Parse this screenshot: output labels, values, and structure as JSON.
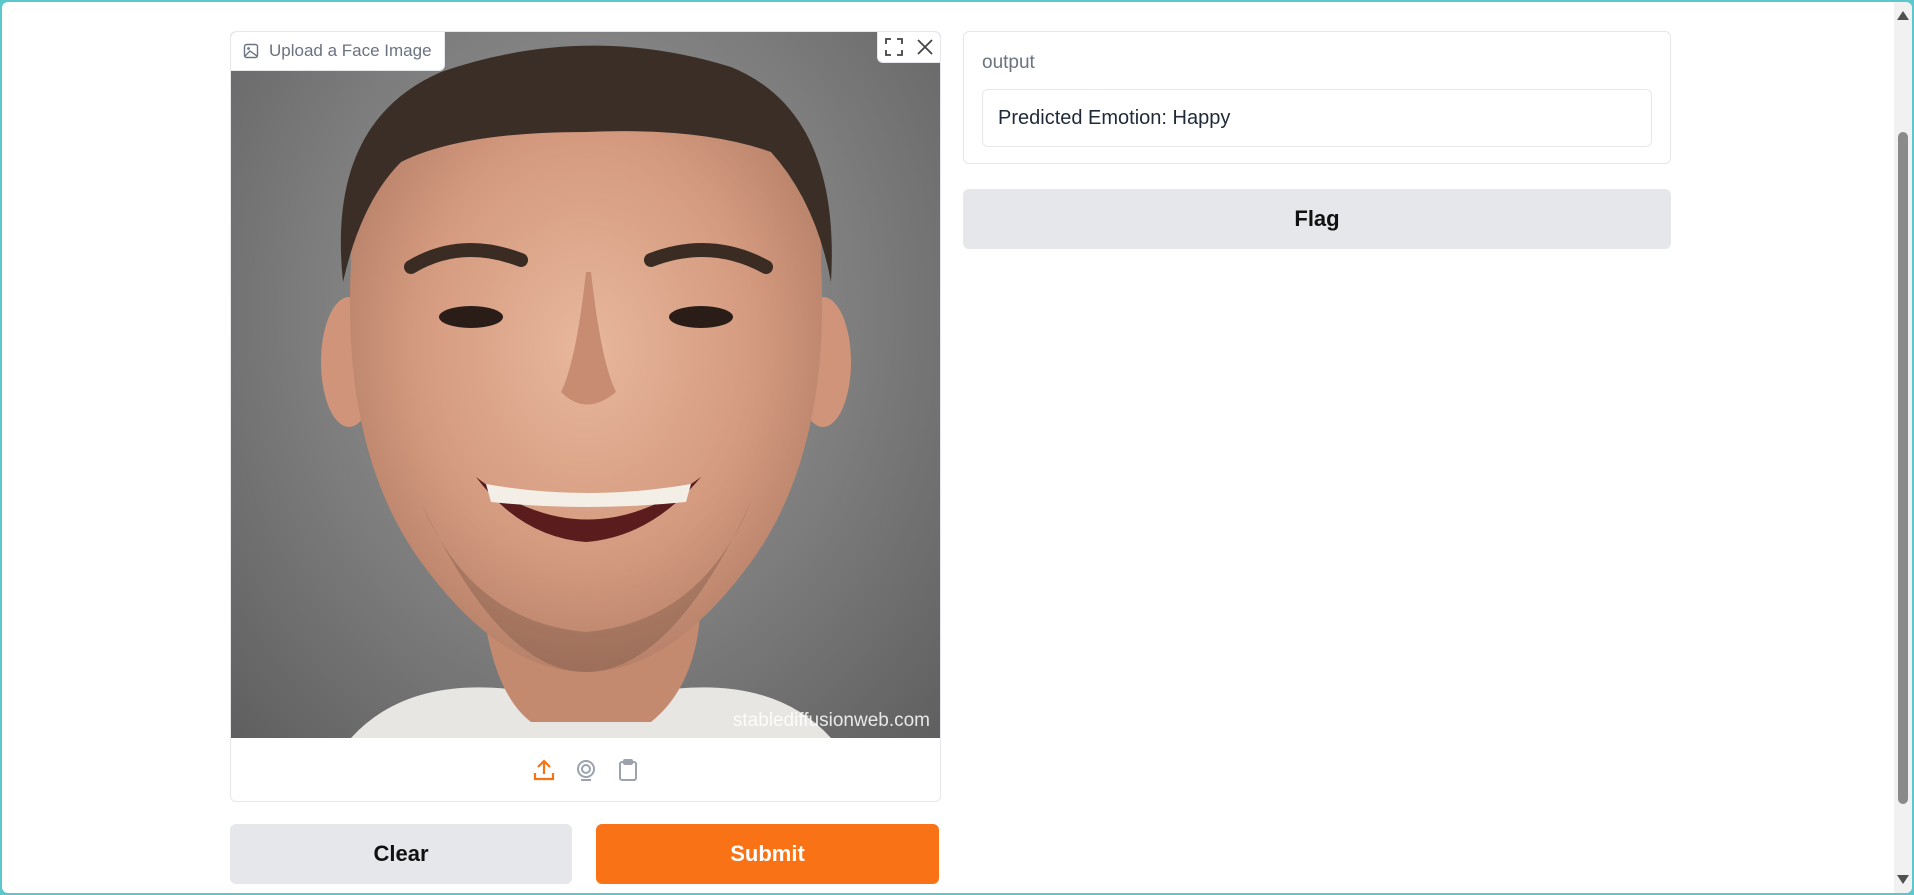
{
  "input": {
    "label": "Upload a Face Image",
    "watermark": "stablediffusionweb.com",
    "photo_alt": "smiling man portrait",
    "tools": [
      "fullscreen-icon",
      "close-icon"
    ],
    "sources": [
      "upload-icon",
      "webcam-icon",
      "clipboard-icon"
    ]
  },
  "output": {
    "label": "output",
    "value": "Predicted Emotion: Happy"
  },
  "buttons": {
    "clear": "Clear",
    "submit": "Submit",
    "flag": "Flag"
  },
  "colors": {
    "accent": "#f97316",
    "secondary_button": "#e5e7eb",
    "window_border": "#5cc8cc"
  }
}
